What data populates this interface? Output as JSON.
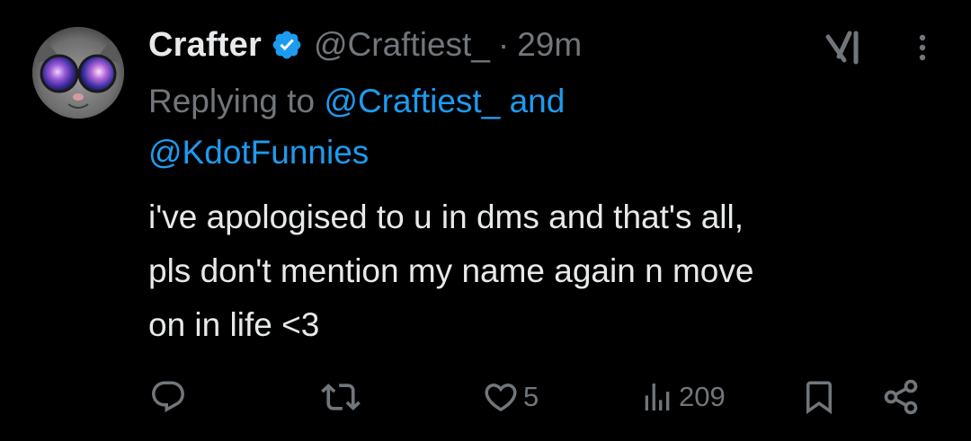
{
  "tweet": {
    "display_name": "Crafter",
    "handle": "@Craftiest_",
    "separator": "·",
    "timestamp": "29m",
    "replying_prefix": "Replying to",
    "replying_mention_1": "@Craftiest_",
    "replying_and": "and",
    "replying_mention_2": "@KdotFunnies",
    "body": "i've apologised to u in dms and that's all,\npls don't mention my name again n move\non in life <3"
  },
  "actions": {
    "reply_icon": "comment-icon",
    "retweet_icon": "retweet-icon",
    "like_icon": "heart-icon",
    "like_count": "5",
    "views_icon": "views-bar-chart-icon",
    "views_count": "209",
    "bookmark_icon": "bookmark-icon",
    "share_icon": "share-icon"
  },
  "header_icons": {
    "grok": "grok-icon",
    "more": "more-vertical-icon"
  },
  "colors": {
    "background": "#000000",
    "text": "#e7e9ea",
    "muted": "#71767b",
    "accent": "#1d9bf0"
  }
}
